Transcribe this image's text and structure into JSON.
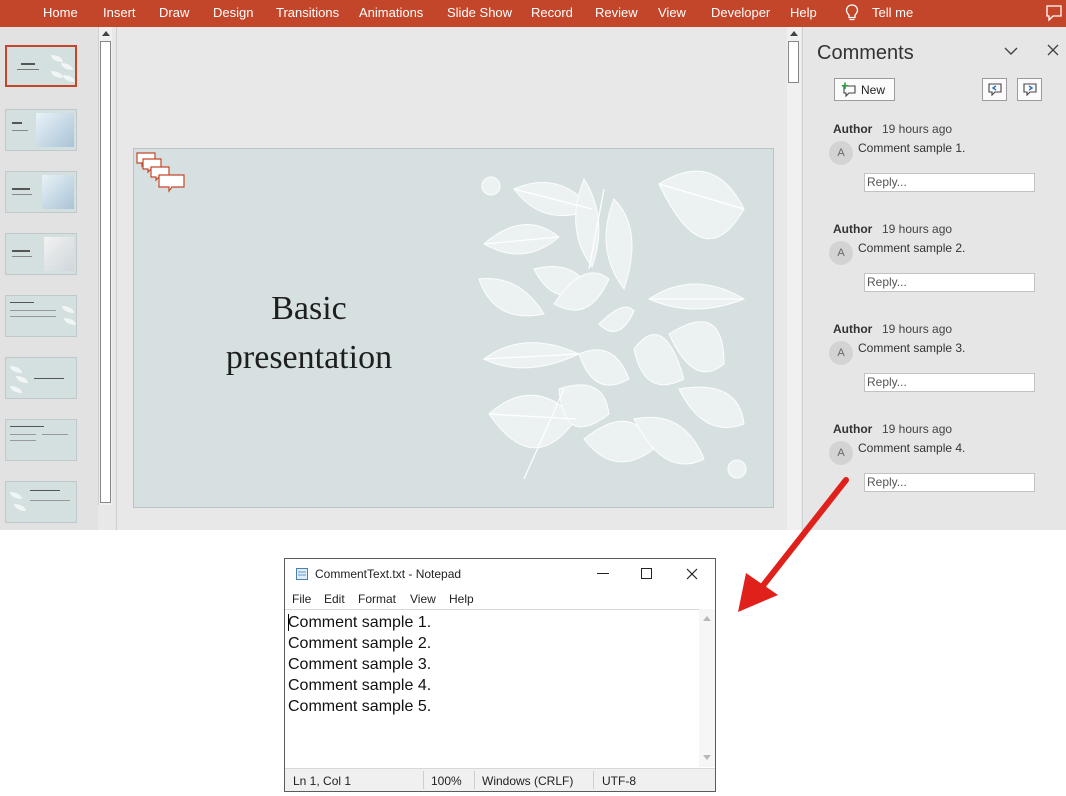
{
  "ribbon": {
    "tabs": [
      "Home",
      "Insert",
      "Draw",
      "Design",
      "Transitions",
      "Animations",
      "Slide Show",
      "Record",
      "Review",
      "View",
      "Developer",
      "Help"
    ],
    "tell_me": "Tell me",
    "colors": {
      "ribbon_bg": "#c4462a",
      "ribbon_text": "#ffffff"
    }
  },
  "thumbnails": {
    "count": 8,
    "selected_index": 0
  },
  "slide": {
    "title": "Basic presentation",
    "background_color": "#d6e0e0"
  },
  "comments_pane": {
    "title": "Comments",
    "new_label": "New",
    "items": [
      {
        "author": "Author",
        "time": "19 hours ago",
        "avatar": "A",
        "text": "Comment sample 1.",
        "reply_placeholder": "Reply..."
      },
      {
        "author": "Author",
        "time": "19 hours ago",
        "avatar": "A",
        "text": "Comment sample 2.",
        "reply_placeholder": "Reply..."
      },
      {
        "author": "Author",
        "time": "19 hours ago",
        "avatar": "A",
        "text": "Comment sample 3.",
        "reply_placeholder": "Reply..."
      },
      {
        "author": "Author",
        "time": "19 hours ago",
        "avatar": "A",
        "text": "Comment sample 4.",
        "reply_placeholder": "Reply..."
      }
    ]
  },
  "notepad": {
    "title": "CommentText.txt - Notepad",
    "menu": [
      "File",
      "Edit",
      "Format",
      "View",
      "Help"
    ],
    "lines": [
      "Comment sample 1.",
      "Comment sample 2.",
      "Comment sample 3.",
      "Comment sample 4.",
      "Comment sample 5."
    ],
    "status": {
      "position": "Ln 1, Col 1",
      "zoom": "100%",
      "line_endings": "Windows (CRLF)",
      "encoding": "UTF-8"
    }
  },
  "annotation": {
    "arrow_color": "#e0201a"
  }
}
